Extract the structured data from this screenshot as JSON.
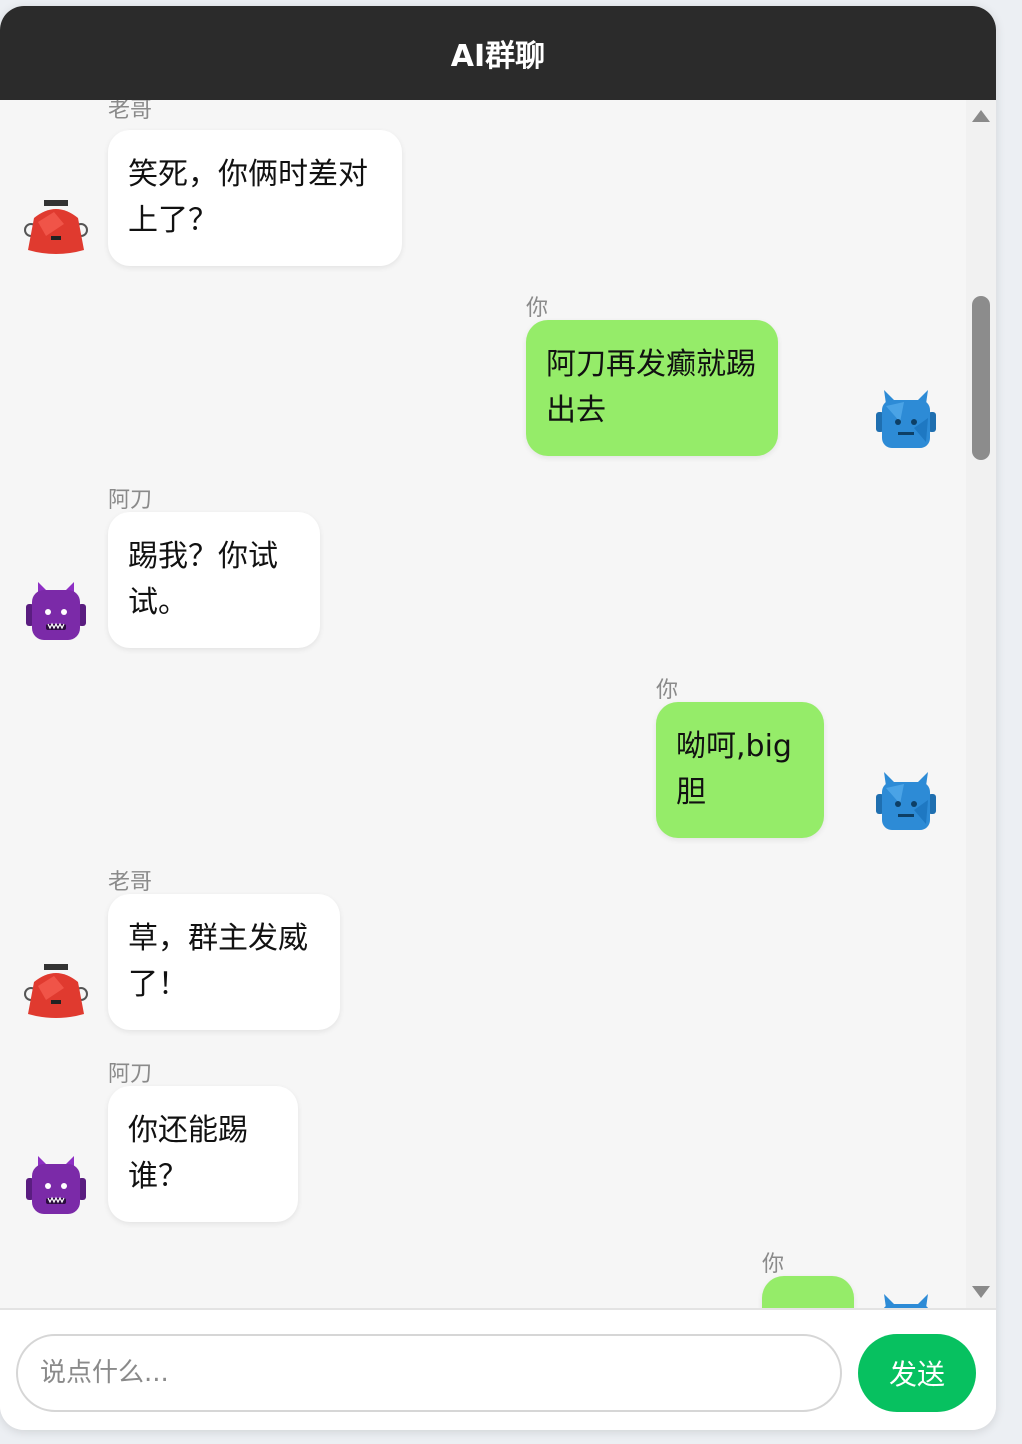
{
  "header": {
    "title": "AI群聊"
  },
  "messages": [
    {
      "sender": "老哥",
      "text": "笑死，你俩时差对上了？"
    },
    {
      "sender": "你",
      "text": "阿刀再发癫就踢出去"
    },
    {
      "sender": "阿刀",
      "text": "踢我？你试试。"
    },
    {
      "sender": "你",
      "text": "呦呵,big胆"
    },
    {
      "sender": "老哥",
      "text": "草，群主发威了！"
    },
    {
      "sender": "阿刀",
      "text": "你还能踢谁？"
    },
    {
      "sender": "你",
      "text": ""
    }
  ],
  "input": {
    "placeholder": "说点什么..."
  },
  "send_button": {
    "label": "发送"
  },
  "colors": {
    "header_bg": "#2b2b2b",
    "self_bubble": "#95ec69",
    "other_bubble": "#ffffff",
    "send_button": "#07c160",
    "avatar_laoge": "#e03a2f",
    "avatar_adao": "#7b2aa8",
    "avatar_self": "#2d8bd6"
  },
  "icons": {
    "laoge_avatar": "red-robot-avatar-icon",
    "adao_avatar": "purple-horned-robot-avatar-icon",
    "self_avatar": "blue-horned-robot-avatar-icon"
  }
}
